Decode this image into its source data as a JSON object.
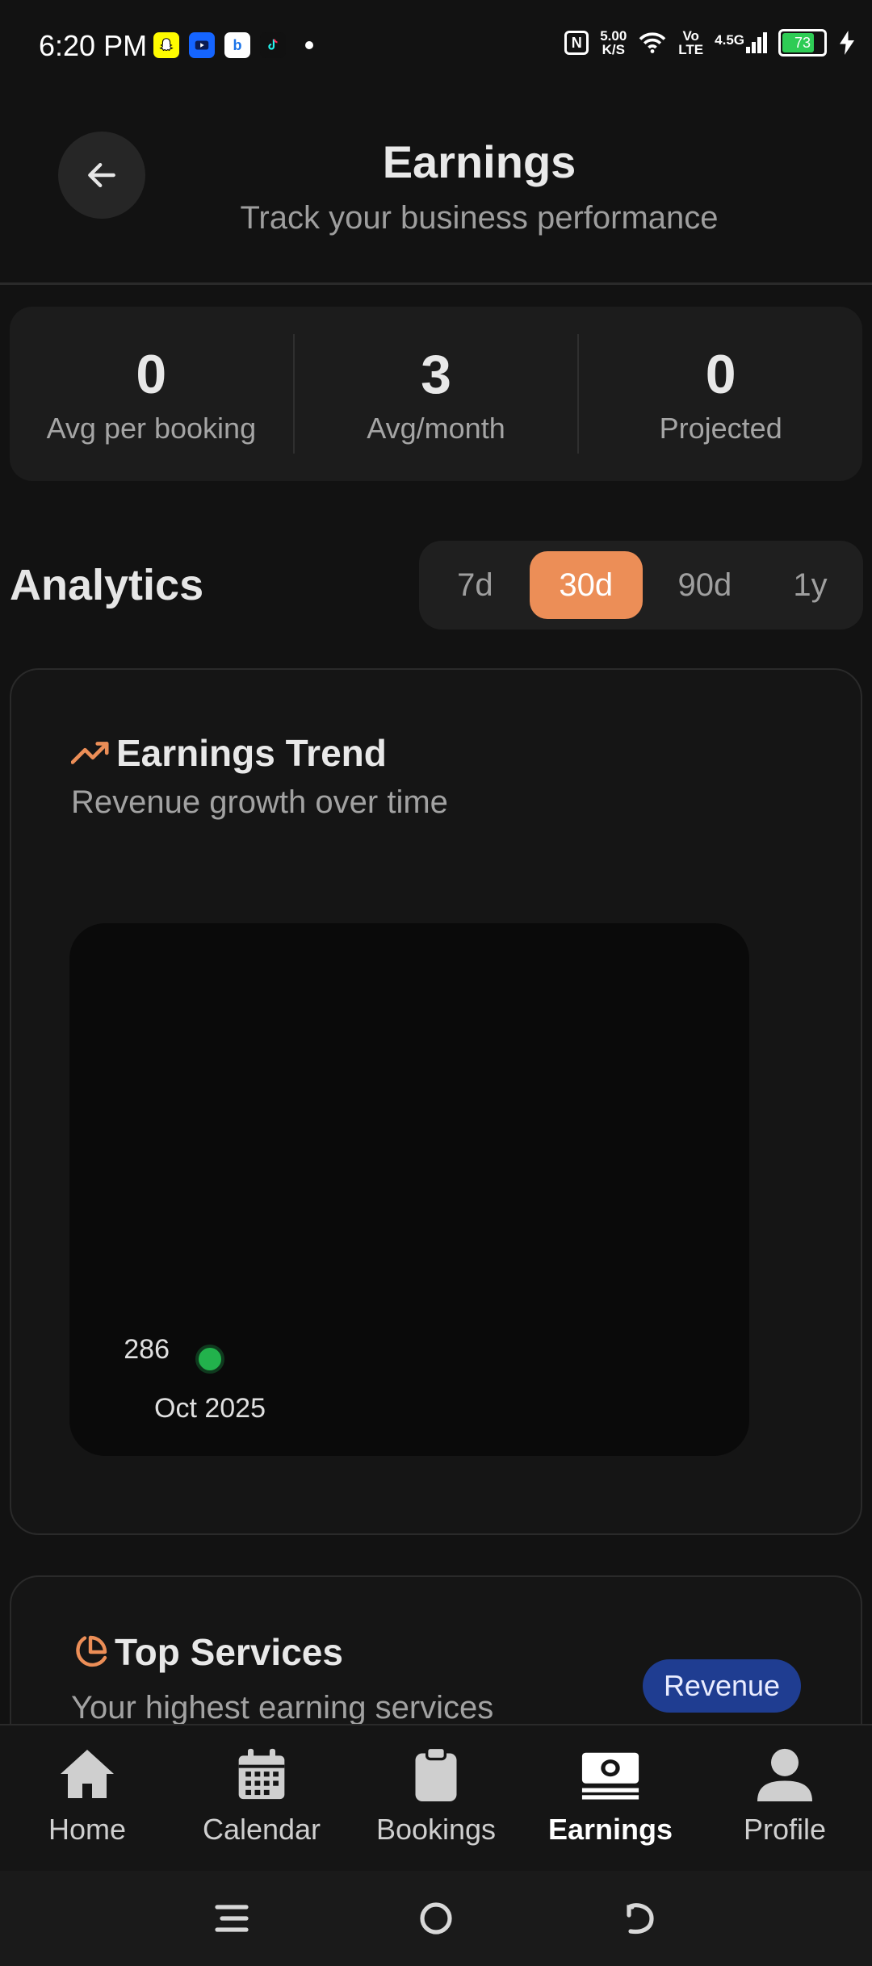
{
  "status_bar": {
    "time": "6:20 PM",
    "app_icons": [
      "snapchat-icon",
      "youtube-studio-icon",
      "bing-icon",
      "tiktok-icon"
    ],
    "net_speed_value": "5.00",
    "net_speed_unit": "K/S",
    "volte": "Vo\nLTE",
    "network": "4.5G",
    "battery": "73"
  },
  "header": {
    "title": "Earnings",
    "subtitle": "Track your business performance"
  },
  "stats": [
    {
      "value": "0",
      "label": "Avg per booking"
    },
    {
      "value": "3",
      "label": "Avg/month"
    },
    {
      "value": "0",
      "label": "Projected"
    }
  ],
  "analytics": {
    "title": "Analytics",
    "ranges": [
      "7d",
      "30d",
      "90d",
      "1y"
    ],
    "selected_range": "30d"
  },
  "trend_card": {
    "title": "Earnings Trend",
    "subtitle": "Revenue growth over time",
    "icon": "trending-up-icon"
  },
  "chart_data": {
    "type": "scatter",
    "x": [
      "Oct 2025"
    ],
    "y": [
      286
    ],
    "point_labels": [
      "286"
    ],
    "point_color": "#22b24c"
  },
  "top_services": {
    "title": "Top Services",
    "subtitle": "Your highest earning services",
    "badge": "Revenue",
    "icon": "pie-chart-icon"
  },
  "bottom_nav": [
    {
      "label": "Home",
      "icon": "home-icon"
    },
    {
      "label": "Calendar",
      "icon": "calendar-icon"
    },
    {
      "label": "Bookings",
      "icon": "clipboard-icon"
    },
    {
      "label": "Earnings",
      "icon": "money-icon"
    },
    {
      "label": "Profile",
      "icon": "person-icon"
    }
  ],
  "active_nav": "Earnings",
  "colors": {
    "accent": "#ec8e57",
    "background": "#121212",
    "badge": "#1f3d91",
    "point": "#22b24c"
  }
}
